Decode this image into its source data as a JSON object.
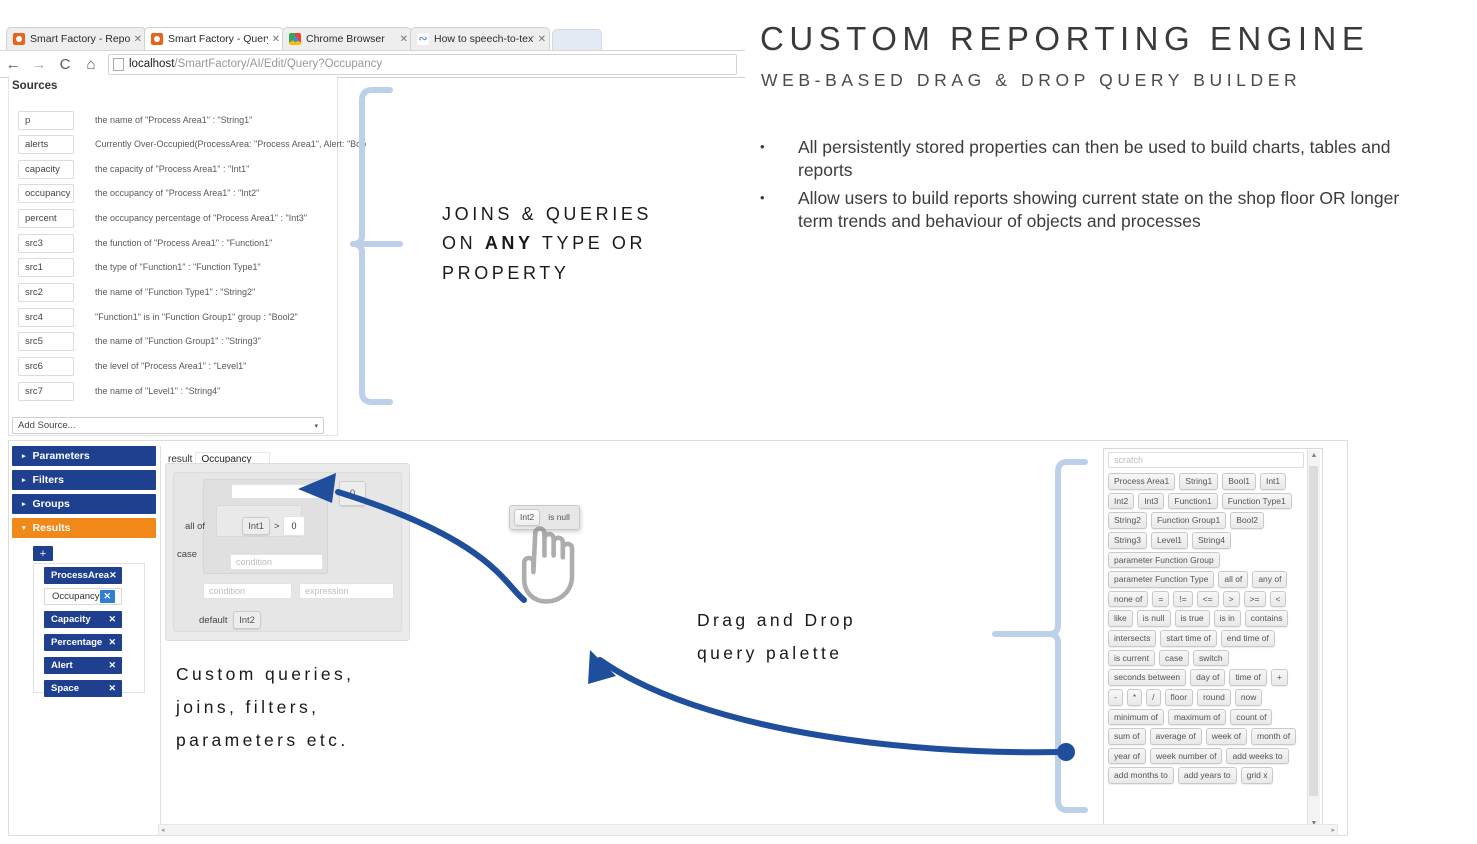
{
  "browser": {
    "tabs": [
      {
        "title": "Smart Factory - Report",
        "icon": "smartfactory-icon",
        "active": false
      },
      {
        "title": "Smart Factory - Query Edi",
        "icon": "smartfactory-icon",
        "active": true
      },
      {
        "title": "Chrome Browser",
        "icon": "chrome-icon",
        "active": false
      },
      {
        "title": "How to speech-to-text in",
        "icon": "speech-icon",
        "active": false
      }
    ],
    "close_glyph": "✕",
    "nav": {
      "back": "←",
      "forward": "→",
      "reload": "C",
      "home": "⌂"
    },
    "url_host": "localhost",
    "url_path": "/SmartFactory/AI/Edit/Query?Occupancy"
  },
  "sources": {
    "heading": "Sources",
    "rows": [
      {
        "key": "p",
        "desc": "the name of \"Process Area1\" : \"String1\""
      },
      {
        "key": "alerts",
        "desc": "Currently Over-Occupied(ProcessArea: \"Process Area1\", Alert: \"Boo"
      },
      {
        "key": "capacity",
        "desc": "the capacity of \"Process Area1\" : \"Int1\""
      },
      {
        "key": "occupancy",
        "desc": "the occupancy of \"Process Area1\" : \"Int2\""
      },
      {
        "key": "percent",
        "desc": "the occupancy percentage of \"Process Area1\" : \"Int3\""
      },
      {
        "key": "src3",
        "desc": "the function of \"Process Area1\" : \"Function1\""
      },
      {
        "key": "src1",
        "desc": "the type of \"Function1\" : \"Function Type1\""
      },
      {
        "key": "src2",
        "desc": "the name of \"Function Type1\" : \"String2\""
      },
      {
        "key": "src4",
        "desc": "\"Function1\" is in \"Function Group1\" group : \"Bool2\""
      },
      {
        "key": "src5",
        "desc": "the name of \"Function Group1\" : \"String3\""
      },
      {
        "key": "src6",
        "desc": "the level of \"Process Area1\" : \"Level1\""
      },
      {
        "key": "src7",
        "desc": "the name of \"Level1\" : \"String4\""
      }
    ],
    "add_source_label": "Add Source...",
    "add_source_caret": "▾"
  },
  "leftnav": {
    "sections": [
      {
        "label": "Parameters",
        "expanded": false,
        "tri": "▸"
      },
      {
        "label": "Filters",
        "expanded": false,
        "tri": "▸"
      },
      {
        "label": "Groups",
        "expanded": false,
        "tri": "▸"
      },
      {
        "label": "Results",
        "expanded": true,
        "tri": "▾"
      }
    ],
    "add_button": "+",
    "results": [
      {
        "label": "ProcessArea",
        "selected": false,
        "remove": "✕"
      },
      {
        "label": "Occupancy",
        "selected": true,
        "remove": "✕"
      },
      {
        "label": "Capacity",
        "selected": false,
        "remove": "✕"
      },
      {
        "label": "Percentage",
        "selected": false,
        "remove": "✕"
      },
      {
        "label": "Alert",
        "selected": false,
        "remove": "✕"
      },
      {
        "label": "Space",
        "selected": false,
        "remove": "✕"
      }
    ],
    "colors": {
      "nav": "#1f3f8f",
      "active": "#f0881a"
    }
  },
  "editor": {
    "result_label": "result",
    "result_value": "Occupancy",
    "case_label": "case",
    "default_label": "default",
    "default_value": "Int2",
    "allof_label": "all of",
    "allof_operand": "Int1",
    "allof_operator": ">",
    "allof_value": "0",
    "empty_value": "0",
    "condition_placeholder": "condition",
    "condition_placeholder_2": "condition",
    "expression_placeholder": "expression",
    "top_field_value": ""
  },
  "palette": {
    "scratch_placeholder": "scratch",
    "chips": [
      "Process Area1",
      "String1",
      "Bool1",
      "Int1",
      "Int2",
      "Int3",
      "Function1",
      "Function Type1",
      "String2",
      "Function Group1",
      "Bool2",
      "String3",
      "Level1",
      "String4",
      "parameter Function Group",
      "parameter Function Type",
      "all of",
      "any of",
      "none of",
      "=",
      "!=",
      "<=",
      ">",
      ">=",
      "<",
      "like",
      "is null",
      "is true",
      "is in",
      "contains",
      "intersects",
      "start time of",
      "end time of",
      "is current",
      "case",
      "switch",
      "seconds between",
      "day of",
      "time of",
      "+",
      "-",
      "*",
      "/",
      "floor",
      "round",
      "now",
      "minimum of",
      "maximum of",
      "count of",
      "sum of",
      "average of",
      "week of",
      "month of",
      "year of",
      "week number of",
      "add weeks to",
      "add months to",
      "add years to",
      "grid x"
    ],
    "scroll_up": "▲",
    "scroll_down": "▼",
    "h_scroll_left": "◂",
    "h_scroll_right": "▸"
  },
  "drag_ghost": {
    "chips": [
      "Int2",
      "is null"
    ]
  },
  "slide": {
    "title": "CUSTOM REPORTING ENGINE",
    "subtitle": "WEB-BASED DRAG & DROP QUERY BUILDER",
    "bullet_marker": "•",
    "bullets": [
      "All persistently stored properties can then be used to build charts, tables and reports",
      "Allow users to build reports showing current state on the shop floor OR longer term trends and behaviour of objects and processes"
    ],
    "callouts": {
      "joins_line1": "JOINS & QUERIES",
      "joins_line2_pre": "ON ",
      "joins_line2_strong": "ANY",
      "joins_line2_post": " TYPE OR",
      "joins_line3": "PROPERTY",
      "custom_line1": "Custom queries,",
      "custom_line2": "joins, filters,",
      "custom_line3": "parameters etc.",
      "drag_line1": "Drag and Drop",
      "drag_line2": "query palette"
    },
    "colors": {
      "bracket": "#bcd0ea",
      "arrow": "#1f4e9c",
      "title": "#3a3a3a"
    }
  }
}
